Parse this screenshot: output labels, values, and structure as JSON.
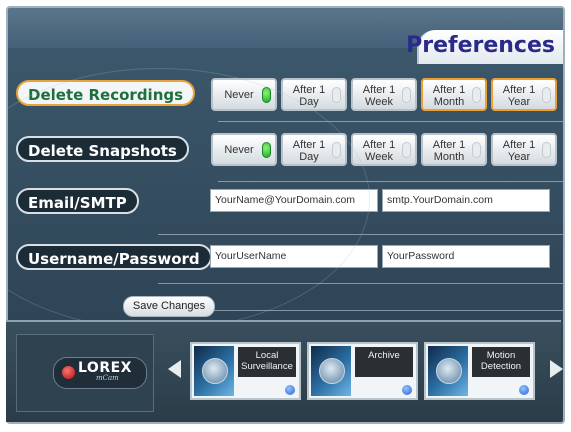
{
  "header": {
    "title": "Preferences"
  },
  "rows": [
    {
      "label": "Delete Recordings",
      "active": true,
      "options": [
        {
          "line1": "Never",
          "line2": "",
          "selected": true,
          "highlighted": false
        },
        {
          "line1": "After 1",
          "line2": "Day",
          "selected": false,
          "highlighted": false
        },
        {
          "line1": "After 1",
          "line2": "Week",
          "selected": false,
          "highlighted": false
        },
        {
          "line1": "After 1",
          "line2": "Month",
          "selected": false,
          "highlighted": true
        },
        {
          "line1": "After 1",
          "line2": "Year",
          "selected": false,
          "highlighted": true
        }
      ]
    },
    {
      "label": "Delete Snapshots",
      "active": false,
      "options": [
        {
          "line1": "Never",
          "line2": "",
          "selected": true,
          "highlighted": false
        },
        {
          "line1": "After 1",
          "line2": "Day",
          "selected": false,
          "highlighted": false
        },
        {
          "line1": "After 1",
          "line2": "Week",
          "selected": false,
          "highlighted": false
        },
        {
          "line1": "After 1",
          "line2": "Month",
          "selected": false,
          "highlighted": false
        },
        {
          "line1": "After 1",
          "line2": "Year",
          "selected": false,
          "highlighted": false
        }
      ]
    }
  ],
  "email": {
    "label": "Email/SMTP",
    "address": "YourName@YourDomain.com",
    "smtp": "smtp.YourDomain.com"
  },
  "credentials": {
    "label": "Username/Password",
    "username": "YourUserName",
    "password": "YourPassword"
  },
  "save_label": "Save Changes",
  "logo": {
    "brand": "LOREX",
    "sub": "mCam"
  },
  "nav_tiles": [
    {
      "label": "Local Surveillance",
      "icon": "camera-dome-icon"
    },
    {
      "label": "Archive",
      "icon": "film-reel-icon"
    },
    {
      "label": "Motion Detection",
      "icon": "running-person-icon"
    }
  ],
  "colors": {
    "title": "#2a2a8a",
    "active_label_text": "#1f6f3c",
    "active_border": "#e8a33a",
    "led_on": "#1faa2b",
    "panel_bg": "#324a5c"
  }
}
